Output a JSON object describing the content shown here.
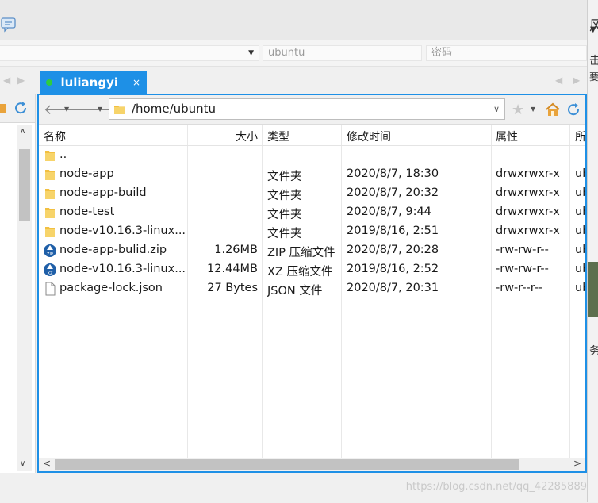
{
  "connection": {
    "username_placeholder": "ubuntu",
    "password_placeholder": "密码"
  },
  "tab": {
    "title": "luliangyi",
    "close_glyph": "×",
    "status_color": "#2ecc40",
    "accent": "#1e90e6"
  },
  "toolbar": {
    "back_icon": "back-arrow-icon",
    "forward_icon": "forward-arrow-icon",
    "path": "/home/ubuntu",
    "bookmark_icon": "star-icon",
    "home_icon": "home-icon",
    "refresh_icon": "refresh-icon"
  },
  "columns": {
    "name": "名称",
    "size": "大小",
    "type": "类型",
    "modified": "修改时间",
    "attributes": "属性",
    "owner": "所有"
  },
  "files": [
    {
      "icon": "folder-icon",
      "name": "..",
      "size": "",
      "type": "",
      "modified": "",
      "attributes": "",
      "owner": ""
    },
    {
      "icon": "folder-icon",
      "name": "node-app",
      "size": "",
      "type": "文件夹",
      "modified": "2020/8/7, 18:30",
      "attributes": "drwxrwxr-x",
      "owner": "ub"
    },
    {
      "icon": "folder-icon",
      "name": "node-app-build",
      "size": "",
      "type": "文件夹",
      "modified": "2020/8/7, 20:32",
      "attributes": "drwxrwxr-x",
      "owner": "ub"
    },
    {
      "icon": "folder-icon",
      "name": "node-test",
      "size": "",
      "type": "文件夹",
      "modified": "2020/8/7, 9:44",
      "attributes": "drwxrwxr-x",
      "owner": "ub"
    },
    {
      "icon": "folder-icon",
      "name": "node-v10.16.3-linux...",
      "size": "",
      "type": "文件夹",
      "modified": "2019/8/16, 2:51",
      "attributes": "drwxrwxr-x",
      "owner": "ub"
    },
    {
      "icon": "zip-file-icon",
      "name": "node-app-bulid.zip",
      "size": "1.26MB",
      "type": "ZIP 压缩文件",
      "modified": "2020/8/7, 20:28",
      "attributes": "-rw-rw-r--",
      "owner": "ub"
    },
    {
      "icon": "xz-file-icon",
      "name": "node-v10.16.3-linux...",
      "size": "12.44MB",
      "type": "XZ 压缩文件",
      "modified": "2019/8/16, 2:52",
      "attributes": "-rw-rw-r--",
      "owner": "ub"
    },
    {
      "icon": "document-icon",
      "name": "package-lock.json",
      "size": "27 Bytes",
      "type": "JSON 文件",
      "modified": "2020/8/7, 20:31",
      "attributes": "-rw-r--r--",
      "owner": "ub"
    }
  ],
  "side_text": {
    "a": "风",
    "b": "击",
    "c": "要",
    "d": "务"
  },
  "watermark": "https://blog.csdn.net/qq_42285889"
}
